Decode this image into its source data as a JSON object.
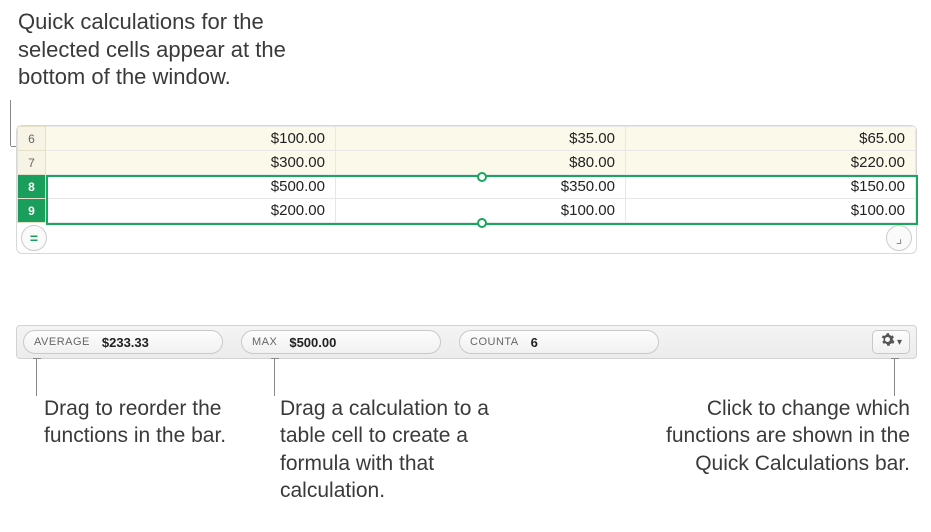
{
  "callouts": {
    "top": "Quick calculations for the selected cells appear at the bottom of the window.",
    "left": "Drag to reorder the functions in the bar.",
    "mid": "Drag a calculation to a table cell to create a formula with that calculation.",
    "right": "Click to change which functions are shown in the Quick Calculations bar."
  },
  "rows": [
    {
      "num": "6",
      "selected": false,
      "yellow": true,
      "a": "$100.00",
      "b": "$35.00",
      "c": "$65.00"
    },
    {
      "num": "7",
      "selected": false,
      "yellow": true,
      "a": "$300.00",
      "b": "$80.00",
      "c": "$220.00"
    },
    {
      "num": "8",
      "selected": true,
      "yellow": false,
      "a": "$500.00",
      "b": "$350.00",
      "c": "$150.00"
    },
    {
      "num": "9",
      "selected": true,
      "yellow": false,
      "a": "$200.00",
      "b": "$100.00",
      "c": "$100.00"
    }
  ],
  "quickcalc": {
    "pills": [
      {
        "label": "AVERAGE",
        "value": "$233.33"
      },
      {
        "label": "MAX",
        "value": "$500.00"
      },
      {
        "label": "COUNTA",
        "value": "6"
      }
    ]
  },
  "corner_left_glyph": "=",
  "corner_right_glyph": "⌟"
}
